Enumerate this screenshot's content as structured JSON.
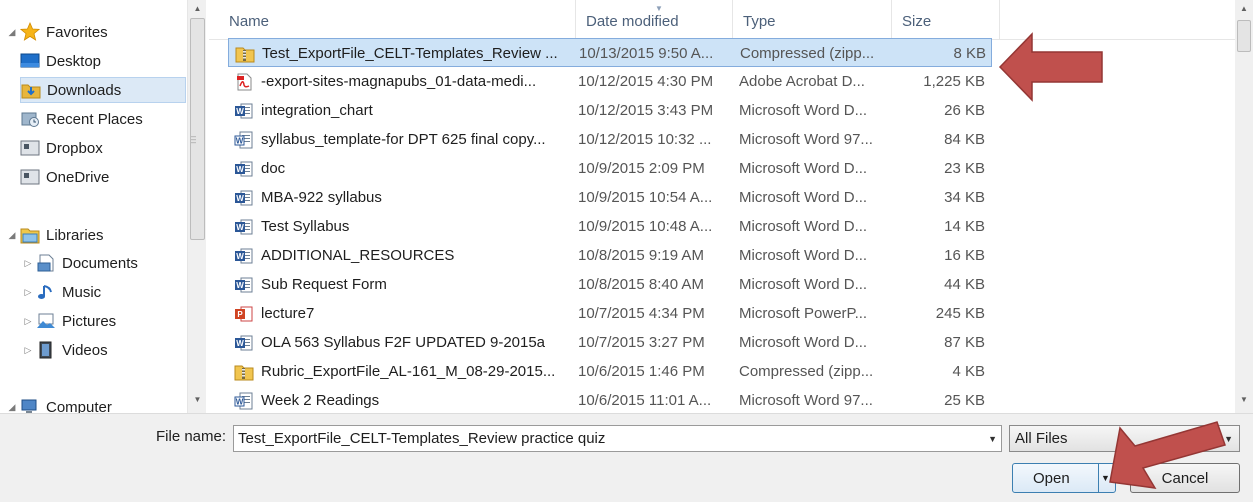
{
  "nav": {
    "favorites": "Favorites",
    "items": [
      {
        "label": "Desktop",
        "icon": "desktop-icon"
      },
      {
        "label": "Downloads",
        "icon": "downloads-folder-icon"
      },
      {
        "label": "Recent Places",
        "icon": "recent-places-icon"
      },
      {
        "label": "Dropbox",
        "icon": "dropbox-icon"
      },
      {
        "label": "OneDrive",
        "icon": "onedrive-icon"
      }
    ],
    "libraries": "Libraries",
    "library_items": [
      {
        "label": "Documents",
        "icon": "documents-library-icon"
      },
      {
        "label": "Music",
        "icon": "music-library-icon"
      },
      {
        "label": "Pictures",
        "icon": "pictures-library-icon"
      },
      {
        "label": "Videos",
        "icon": "videos-library-icon"
      }
    ],
    "computer": "Computer"
  },
  "columns": {
    "name": "Name",
    "date": "Date modified",
    "type": "Type",
    "size": "Size"
  },
  "files": [
    {
      "name": "Test_ExportFile_CELT-Templates_Review ...",
      "date": "10/13/2015 9:50 A...",
      "type": "Compressed (zipp...",
      "size": "8 KB",
      "icon": "zip-folder-icon",
      "selected": true
    },
    {
      "name": "-export-sites-magnapubs_01-data-medi...",
      "date": "10/12/2015 4:30 PM",
      "type": "Adobe Acrobat D...",
      "size": "1,225 KB",
      "icon": "pdf-icon"
    },
    {
      "name": "integration_chart",
      "date": "10/12/2015 3:43 PM",
      "type": "Microsoft Word D...",
      "size": "26 KB",
      "icon": "word-icon"
    },
    {
      "name": "syllabus_template-for DPT 625 final copy...",
      "date": "10/12/2015 10:32 ...",
      "type": "Microsoft Word 97...",
      "size": "84 KB",
      "icon": "word97-icon"
    },
    {
      "name": "doc",
      "date": "10/9/2015 2:09 PM",
      "type": "Microsoft Word D...",
      "size": "23 KB",
      "icon": "word-icon"
    },
    {
      "name": "MBA-922 syllabus",
      "date": "10/9/2015 10:54 A...",
      "type": "Microsoft Word D...",
      "size": "34 KB",
      "icon": "word-icon"
    },
    {
      "name": "Test Syllabus",
      "date": "10/9/2015 10:48 A...",
      "type": "Microsoft Word D...",
      "size": "14 KB",
      "icon": "word-icon"
    },
    {
      "name": "ADDITIONAL_RESOURCES",
      "date": "10/8/2015 9:19 AM",
      "type": "Microsoft Word D...",
      "size": "16 KB",
      "icon": "word-icon"
    },
    {
      "name": "Sub Request Form",
      "date": "10/8/2015 8:40 AM",
      "type": "Microsoft Word D...",
      "size": "44 KB",
      "icon": "word-icon"
    },
    {
      "name": "lecture7",
      "date": "10/7/2015 4:34 PM",
      "type": "Microsoft PowerP...",
      "size": "245 KB",
      "icon": "powerpoint-icon"
    },
    {
      "name": "OLA 563 Syllabus F2F UPDATED 9-2015a",
      "date": "10/7/2015 3:27 PM",
      "type": "Microsoft Word D...",
      "size": "87 KB",
      "icon": "word-icon"
    },
    {
      "name": "Rubric_ExportFile_AL-161_M_08-29-2015...",
      "date": "10/6/2015 1:46 PM",
      "type": "Compressed (zipp...",
      "size": "4 KB",
      "icon": "zip-folder-icon"
    },
    {
      "name": "Week 2 Readings",
      "date": "10/6/2015 11:01 A...",
      "type": "Microsoft Word 97...",
      "size": "25 KB",
      "icon": "word97-icon"
    }
  ],
  "bottom": {
    "file_name_label": "File name:",
    "file_name_value": "Test_ExportFile_CELT-Templates_Review practice quiz",
    "file_type": "All Files",
    "open_label": "Open",
    "cancel_label": "Cancel"
  },
  "colors": {
    "selection": "#cde3f7",
    "selection_border": "#84acdd",
    "annotation_arrow": "#c0504d",
    "header_text": "#4c607a"
  }
}
